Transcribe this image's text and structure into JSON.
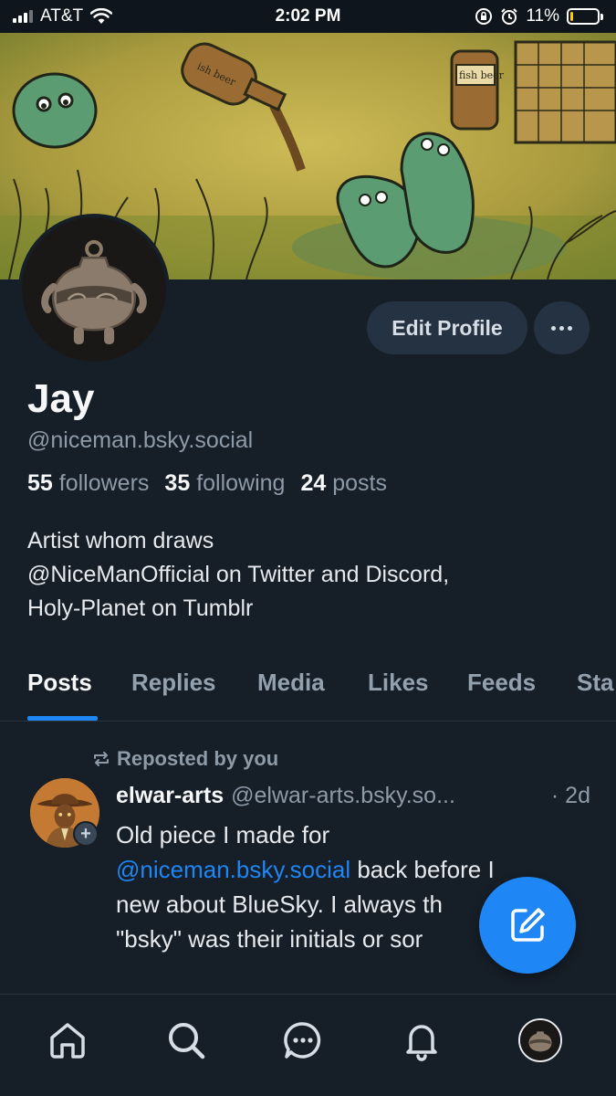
{
  "status_bar": {
    "carrier": "AT&T",
    "time": "2:02 PM",
    "battery_percent": "11%",
    "battery_level": 0.11,
    "icons": [
      "signal-icon",
      "wifi-icon",
      "lock-rotation-icon",
      "alarm-icon",
      "battery-icon"
    ]
  },
  "banner": {
    "bottle_label_1": "ish beer",
    "bottle_label_2": "fish beer"
  },
  "profile": {
    "display_name": "Jay",
    "handle": "@niceman.bsky.social",
    "edit_button": "Edit Profile",
    "followers_count": "55",
    "followers_label": "followers",
    "following_count": "35",
    "following_label": "following",
    "posts_count": "24",
    "posts_label": "posts",
    "bio_lines": [
      "Artist whom draws",
      "@NiceManOfficial on Twitter and Discord,",
      "Holy-Planet on Tumblr"
    ]
  },
  "tabs": [
    "Posts",
    "Replies",
    "Media",
    "Likes",
    "Feeds",
    "Sta"
  ],
  "active_tab": "Posts",
  "post": {
    "repost_label": "Reposted by you",
    "author": "elwar-arts",
    "author_handle": "@elwar-arts.bsky.so...",
    "time": "· 2d",
    "text_1": "Old piece I made for",
    "mention": "@niceman.bsky.social",
    "text_2": " back before I",
    "text_3": "new about BlueSky. I always th",
    "text_4": "\"bsky\" was their initials or sor",
    "text_5": ":)"
  },
  "colors": {
    "background": "#161e27",
    "accent": "#1f86f5",
    "muted_text": "#8d9aa8",
    "button_bg": "#253241"
  },
  "nav": [
    "home-icon",
    "search-icon",
    "chat-icon",
    "bell-icon",
    "profile-avatar"
  ]
}
